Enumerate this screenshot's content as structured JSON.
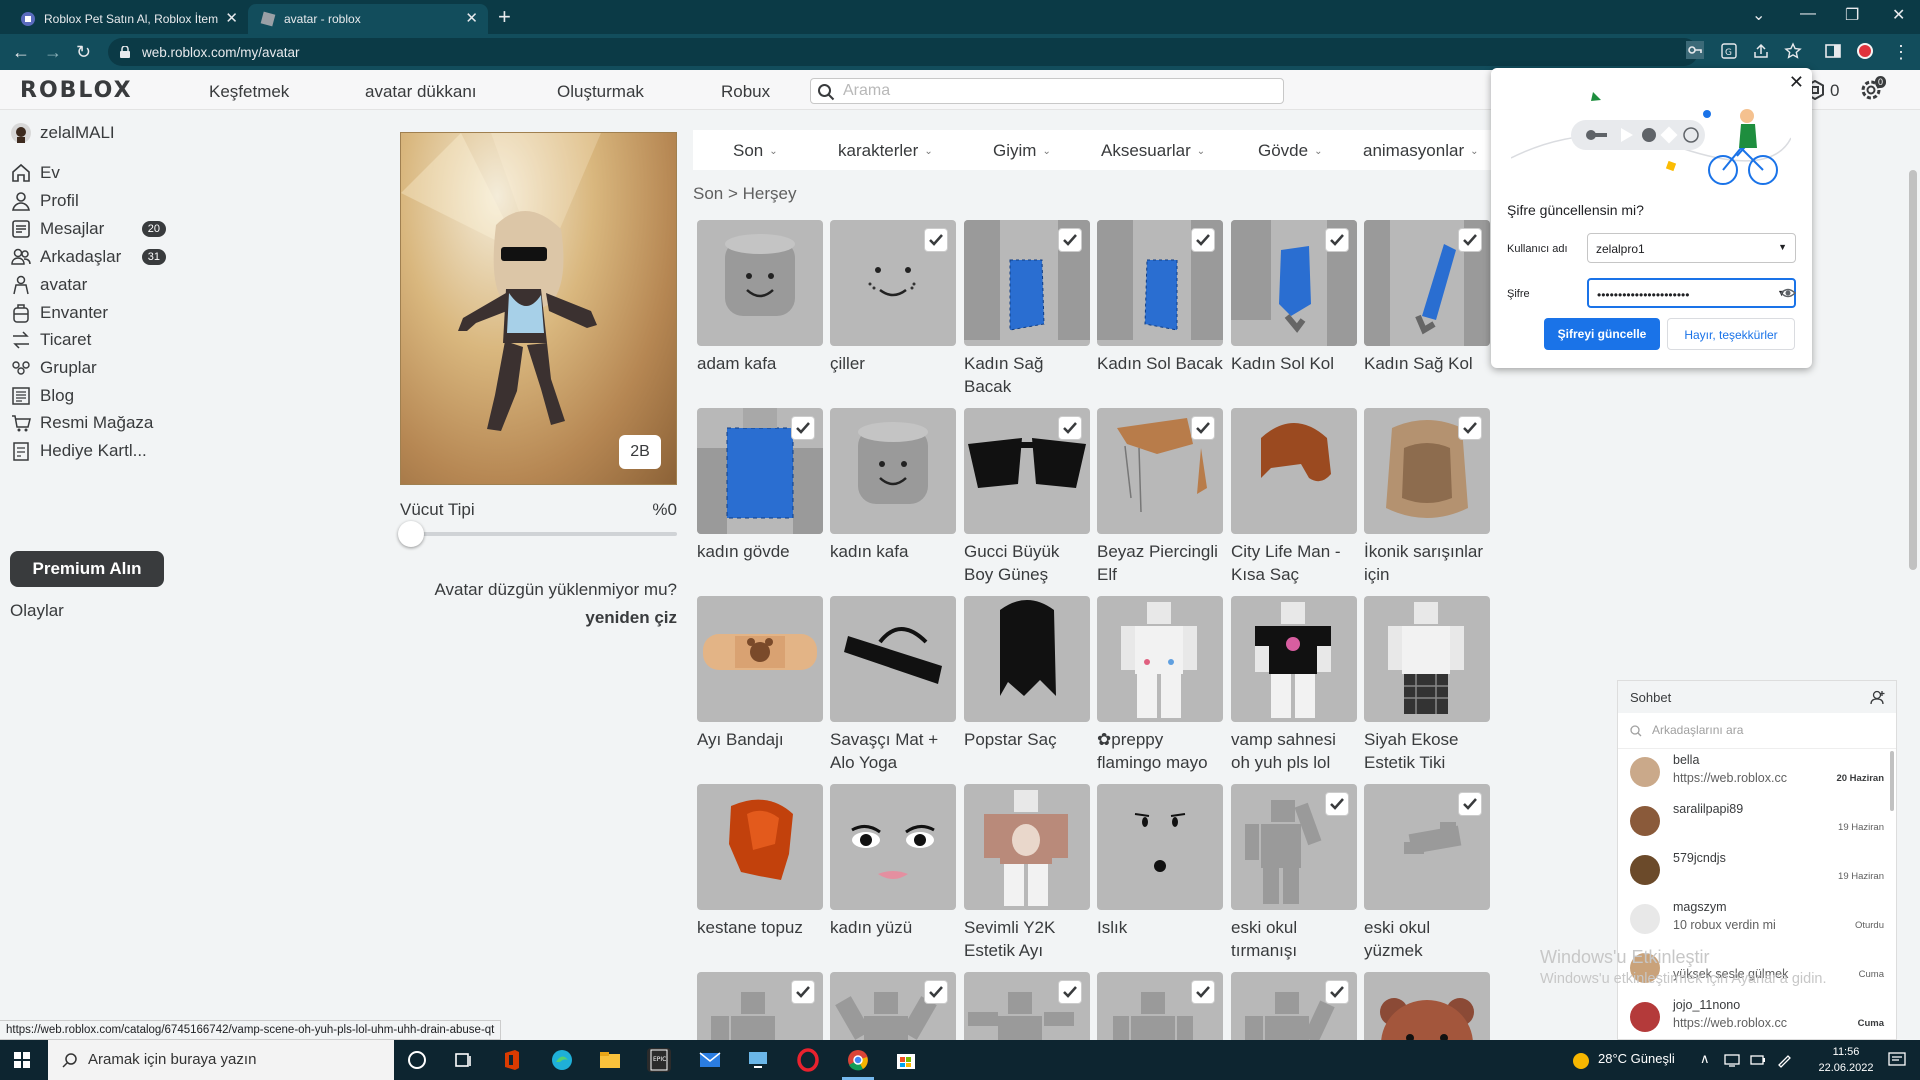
{
  "browser": {
    "tabs": [
      {
        "title": "Roblox Pet Satın Al, Roblox İtem"
      },
      {
        "title": "avatar - roblox"
      }
    ],
    "url": "web.roblox.com/my/avatar",
    "robux_count": "0",
    "notif_count": "0"
  },
  "header": {
    "logo": "ROBLOX",
    "nav": [
      "Keşfetmek",
      "avatar dükkanı",
      "Oluşturmak",
      "Robux"
    ],
    "search_placeholder": "Arama"
  },
  "sidebar": {
    "username": "zelalMALI",
    "items": [
      {
        "label": "Ev",
        "icon": "home-icon"
      },
      {
        "label": "Profil",
        "icon": "profile-icon"
      },
      {
        "label": "Mesajlar",
        "icon": "messages-icon",
        "badge": "20"
      },
      {
        "label": "Arkadaşlar",
        "icon": "friends-icon",
        "badge": "31"
      },
      {
        "label": "avatar",
        "icon": "avatar-icon"
      },
      {
        "label": "Envanter",
        "icon": "inventory-icon"
      },
      {
        "label": "Ticaret",
        "icon": "trade-icon"
      },
      {
        "label": "Gruplar",
        "icon": "groups-icon"
      },
      {
        "label": "Blog",
        "icon": "blog-icon"
      },
      {
        "label": "Resmi Mağaza",
        "icon": "store-icon"
      },
      {
        "label": "Hediye Kartl...",
        "icon": "gift-card-icon"
      }
    ],
    "premium": "Premium Alın",
    "events": "Olaylar"
  },
  "avatar": {
    "toggle_label": "2B",
    "body_type_label": "Vücut Tipi",
    "body_type_value": "%0",
    "body_type_fraction": 0,
    "not_loading": "Avatar düzgün yüklenmiyor mu?",
    "redraw": "yeniden çiz"
  },
  "categories": [
    "Son",
    "karakterler",
    "Giyim",
    "Aksesuarlar",
    "Gövde",
    "animasyonlar"
  ],
  "breadcrumb": {
    "root": "Son",
    "sep": ">",
    "current": "Herşey"
  },
  "items": [
    {
      "name": "adam kafa",
      "checked": false
    },
    {
      "name": "çiller",
      "checked": true
    },
    {
      "name": "Kadın Sağ Bacak",
      "checked": true
    },
    {
      "name": "Kadın Sol Bacak",
      "checked": true
    },
    {
      "name": "Kadın Sol Kol",
      "checked": true
    },
    {
      "name": "Kadın Sağ Kol",
      "checked": true
    },
    {
      "name": "kadın gövde",
      "checked": true
    },
    {
      "name": "kadın kafa",
      "checked": false
    },
    {
      "name": "Gucci Büyük Boy Güneş",
      "checked": true
    },
    {
      "name": "Beyaz Piercingli Elf",
      "checked": true
    },
    {
      "name": "City Life Man - Kısa Saç",
      "checked": false
    },
    {
      "name": "İkonik sarışınlar için",
      "checked": true
    },
    {
      "name": "Ayı Bandajı",
      "checked": false
    },
    {
      "name": "Savaşçı Mat + Alo Yoga",
      "checked": false
    },
    {
      "name": "Popstar Saç",
      "checked": false
    },
    {
      "name": "✿preppy flamingo mayo",
      "checked": false
    },
    {
      "name": "vamp sahnesi oh yuh pls lol",
      "checked": false
    },
    {
      "name": "Siyah Ekose Estetik Tiki",
      "checked": false
    },
    {
      "name": "kestane topuz",
      "checked": false
    },
    {
      "name": "kadın yüzü",
      "checked": false
    },
    {
      "name": "Sevimli Y2K Estetik Ayı",
      "checked": false
    },
    {
      "name": "Islık",
      "checked": false
    },
    {
      "name": "eski okul tırmanışı",
      "checked": true
    },
    {
      "name": "eski okul yüzmek",
      "checked": true
    },
    {
      "name": "",
      "checked": true
    },
    {
      "name": "",
      "checked": true
    },
    {
      "name": "",
      "checked": true
    },
    {
      "name": "",
      "checked": true
    },
    {
      "name": "",
      "checked": true
    },
    {
      "name": "",
      "checked": false
    }
  ],
  "password_prompt": {
    "title": "Şifre güncellensin mi?",
    "username_label": "Kullanıcı adı",
    "username_value": "zelalpro1",
    "password_label": "Şifre",
    "password_value": "••••••••••••••••••••••",
    "update_btn": "Şifreyi güncelle",
    "no_btn": "Hayır, teşekkürler"
  },
  "chat": {
    "title": "Sohbet",
    "search_placeholder": "Arkadaşlarını ara",
    "convos": [
      {
        "name": "bella",
        "msg": "https://web.roblox.cc",
        "date": "20 Haziran",
        "bold": true
      },
      {
        "name": "saralilpapi89",
        "msg": "",
        "date": "19 Haziran",
        "bold": false
      },
      {
        "name": "579jcndjs",
        "msg": "",
        "date": "19 Haziran",
        "bold": false
      },
      {
        "name": "magszym",
        "msg": "10 robux verdin mi",
        "date": "Oturdu",
        "bold": false
      },
      {
        "name": "",
        "msg": "yüksek sesle gülmek",
        "date": "Cuma",
        "bold": false
      },
      {
        "name": "jojo_11nono",
        "msg": "https://web.roblox.cc",
        "date": "Cuma",
        "bold": true
      }
    ]
  },
  "watermark": {
    "line1": "Windows'u Etkinleştir",
    "line2": "Windows'u etkinleştirmek için Ayarlar'a gidin."
  },
  "status_url": "https://web.roblox.com/catalog/6745166742/vamp-scene-oh-yuh-pls-lol-uhm-uhh-drain-abuse-qt",
  "taskbar": {
    "search_placeholder": "Aramak için buraya yazın",
    "weather": "28°C  Güneşli",
    "time": "11:56",
    "date": "22.06.2022"
  },
  "colors": {
    "accent": "#1a73e8",
    "chrome_dark": "#0b3a46",
    "roblox_text": "#393b3d"
  }
}
